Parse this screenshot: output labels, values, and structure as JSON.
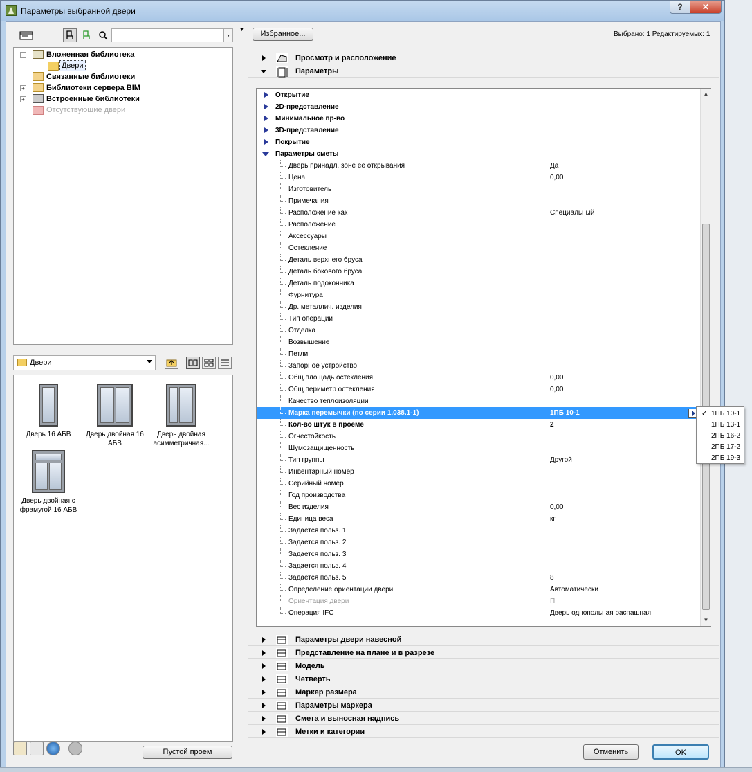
{
  "window": {
    "title": "Параметры выбранной двери",
    "help_label": "?",
    "close_label": "✕"
  },
  "left": {
    "search_placeholder": "",
    "search_go": "›",
    "tree": [
      {
        "label": "Вложенная библиотека",
        "bold": true,
        "toggle": "−"
      },
      {
        "label": "Двери",
        "bold": false,
        "toggle": ""
      },
      {
        "label": "Связанные библиотеки",
        "bold": true,
        "toggle": ""
      },
      {
        "label": "Библиотеки сервера BIM",
        "bold": true,
        "toggle": "+"
      },
      {
        "label": "Встроенные библиотеки",
        "bold": true,
        "toggle": "+"
      },
      {
        "label": "Отсутствующие двери",
        "bold": false,
        "toggle": ""
      }
    ],
    "folder_select": "Двери",
    "thumbnails": [
      {
        "label": "Дверь 16 АБВ"
      },
      {
        "label": "Дверь двойная 16 АБВ"
      },
      {
        "label": "Дверь двойная асимметричная..."
      },
      {
        "label": "Дверь двойная с фрамугой 16 АБВ"
      }
    ],
    "empty_opening_button": "Пустой проем"
  },
  "right": {
    "favorites_button": "Избранное...",
    "selection_info": "Выбрано: 1 Редактируемых: 1",
    "sections_top": [
      {
        "label": "Просмотр и расположение",
        "expanded": false
      },
      {
        "label": "Параметры",
        "expanded": true
      }
    ],
    "groups": [
      {
        "label": "Открытие"
      },
      {
        "label": "2D-представление"
      },
      {
        "label": "Минимальное пр-во"
      },
      {
        "label": "3D-представление"
      },
      {
        "label": "Покрытие"
      },
      {
        "label": "Параметры сметы"
      }
    ],
    "params": [
      {
        "label": "Дверь принадл. зоне ее открывания",
        "value": "Да"
      },
      {
        "label": "Цена",
        "value": "0,00"
      },
      {
        "label": "Изготовитель",
        "value": ""
      },
      {
        "label": "Примечания",
        "value": ""
      },
      {
        "label": "Расположение как",
        "value": "Специальный"
      },
      {
        "label": "Расположение",
        "value": ""
      },
      {
        "label": "Аксессуары",
        "value": ""
      },
      {
        "label": "Остекление",
        "value": ""
      },
      {
        "label": "Деталь верхнего бруса",
        "value": ""
      },
      {
        "label": "Деталь бокового бруса",
        "value": ""
      },
      {
        "label": "Деталь подоконника",
        "value": ""
      },
      {
        "label": "Фурнитура",
        "value": ""
      },
      {
        "label": "Др. металлич. изделия",
        "value": ""
      },
      {
        "label": "Тип операции",
        "value": ""
      },
      {
        "label": "Отделка",
        "value": ""
      },
      {
        "label": "Возвышение",
        "value": ""
      },
      {
        "label": "Петли",
        "value": ""
      },
      {
        "label": "Запорное устройство",
        "value": ""
      },
      {
        "label": "Общ.площадь остекления",
        "value": "0,00"
      },
      {
        "label": "Общ.периметр остекления",
        "value": "0,00"
      },
      {
        "label": "Качество теплоизоляции",
        "value": ""
      },
      {
        "label": "Марка перемычки (по серии 1.038.1-1)",
        "value": "1ПБ 10-1",
        "state": "selected"
      },
      {
        "label": "Кол-во штук в проеме",
        "value": "2",
        "state": "bold"
      },
      {
        "label": "Огнестойкость",
        "value": ""
      },
      {
        "label": "Шумозащищенность",
        "value": ""
      },
      {
        "label": "Тип группы",
        "value": "Другой"
      },
      {
        "label": "Инвентарный номер",
        "value": ""
      },
      {
        "label": "Серийный номер",
        "value": ""
      },
      {
        "label": "Год производства",
        "value": ""
      },
      {
        "label": "Вес изделия",
        "value": "0,00"
      },
      {
        "label": "Единица веса",
        "value": "кг"
      },
      {
        "label": "Задается польз. 1",
        "value": ""
      },
      {
        "label": "Задается польз. 2",
        "value": ""
      },
      {
        "label": "Задается польз. 3",
        "value": ""
      },
      {
        "label": "Задается польз. 4",
        "value": ""
      },
      {
        "label": "Задается польз. 5",
        "value": "8"
      },
      {
        "label": "Определение ориентации двери",
        "value": "Автоматически"
      },
      {
        "label": "Ориентация двери",
        "value": "П",
        "state": "disabled"
      },
      {
        "label": "Операция IFC",
        "value": "Дверь однопольная распашная"
      }
    ],
    "popup_options": [
      {
        "label": "1ПБ 10-1",
        "checked": true
      },
      {
        "label": "1ПБ 13-1",
        "checked": false
      },
      {
        "label": "2ПБ 16-2",
        "checked": false
      },
      {
        "label": "2ПБ 17-2",
        "checked": false
      },
      {
        "label": "2ПБ 19-3",
        "checked": false
      }
    ],
    "sections_bottom": [
      {
        "label": "Параметры двери навесной"
      },
      {
        "label": "Представление на плане и в разрезе"
      },
      {
        "label": "Модель"
      },
      {
        "label": "Четверть"
      },
      {
        "label": "Маркер размера"
      },
      {
        "label": "Параметры маркера"
      },
      {
        "label": "Смета и выносная надпись"
      },
      {
        "label": "Метки и категории"
      }
    ],
    "cancel_button": "Отменить",
    "ok_button": "OK"
  },
  "colors": {
    "selection": "#3399ff",
    "group_arrow": "#2a3a9a",
    "title_bar": "#b9d1ea"
  }
}
